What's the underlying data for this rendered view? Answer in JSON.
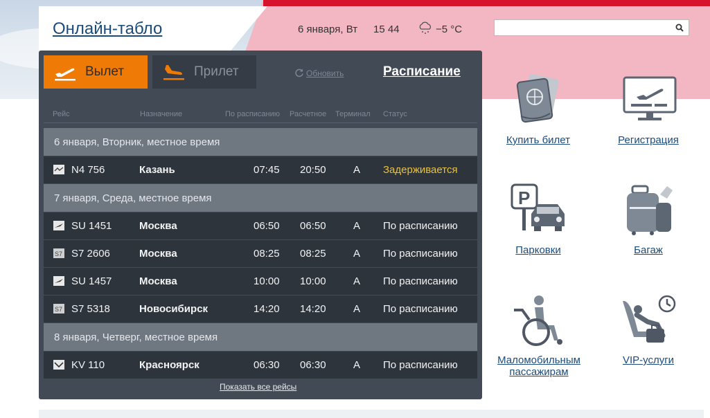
{
  "header": {
    "title": "Онлайн-табло",
    "date": "6 января, Вт",
    "time": "15 44",
    "temperature": "−5 °C",
    "weather_icon": "cloud-snow-icon",
    "search": {
      "placeholder": "",
      "value": ""
    }
  },
  "board": {
    "tabs": [
      {
        "label": "Вылет",
        "icon": "departure-icon",
        "active": true
      },
      {
        "label": "Прилет",
        "icon": "arrival-icon",
        "active": false
      }
    ],
    "refresh_label": "Обновить",
    "schedule_link": "Расписание",
    "columns": [
      "Рейс",
      "Назначение",
      "По расписанию",
      "Расчетное",
      "Терминал",
      "Статус"
    ],
    "date_headers": [
      "6 января, Вторник, местное время",
      "7 января, Среда, местное время",
      "8 января, Четверг, местное время"
    ],
    "flights": [
      {
        "airline_icon": "nordstar-logo-icon",
        "flight": "N4 756",
        "destination": "Казань",
        "scheduled": "07:45",
        "estimated": "20:50",
        "terminal": "A",
        "status": "Задерживается"
      },
      {
        "airline_icon": "aeroflot-logo-icon",
        "flight": "SU 1451",
        "destination": "Москва",
        "scheduled": "06:50",
        "estimated": "06:50",
        "terminal": "A",
        "status": "По расписанию"
      },
      {
        "airline_icon": "s7-logo-icon",
        "flight": "S7 2606",
        "destination": "Москва",
        "scheduled": "08:25",
        "estimated": "08:25",
        "terminal": "A",
        "status": "По расписанию"
      },
      {
        "airline_icon": "aeroflot-logo-icon",
        "flight": "SU 1457",
        "destination": "Москва",
        "scheduled": "10:00",
        "estimated": "10:00",
        "terminal": "A",
        "status": "По расписанию"
      },
      {
        "airline_icon": "s7-logo-icon",
        "flight": "S7 5318",
        "destination": "Новосибирск",
        "scheduled": "14:20",
        "estimated": "14:20",
        "terminal": "A",
        "status": "По расписанию"
      },
      {
        "airline_icon": "kras-air-logo-icon",
        "flight": "KV 110",
        "destination": "Красноярск",
        "scheduled": "06:30",
        "estimated": "06:30",
        "terminal": "A",
        "status": "По расписанию"
      }
    ],
    "show_all": "Показать все рейсы"
  },
  "services": [
    {
      "label": "Купить билет",
      "icon": "passport-ticket-icon"
    },
    {
      "label": "Регистрация",
      "icon": "check-in-monitor-icon"
    },
    {
      "label": "Парковки",
      "icon": "parking-icon"
    },
    {
      "label": "Багаж",
      "icon": "baggage-icon"
    },
    {
      "label": "Маломобильным пассажирам",
      "icon": "wheelchair-icon"
    },
    {
      "label": "VIP-услуги",
      "icon": "vip-lounge-icon"
    }
  ],
  "colors": {
    "accent_orange": "#ef7a05",
    "brand_red": "#d8122c",
    "link_blue": "#1b4b7b",
    "board_bg": "#424a56",
    "status_delayed": "#e7c23e"
  }
}
